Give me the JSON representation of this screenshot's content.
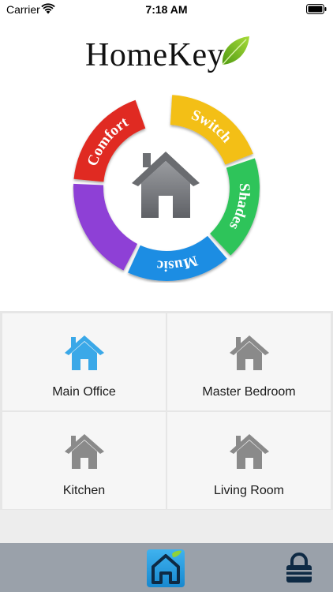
{
  "status_bar": {
    "carrier": "Carrier",
    "time": "7:18 AM"
  },
  "logo": {
    "text": "HomeKey"
  },
  "wheel": {
    "segments": [
      {
        "label": "Switch",
        "color": "#f3bf13"
      },
      {
        "label": "Shades",
        "color": "#2fc45a"
      },
      {
        "label": "Music",
        "color": "#1f8de3"
      },
      {
        "label": "",
        "color": "#8e3fd6"
      },
      {
        "label": "Comfort",
        "color": "#e02a22"
      }
    ]
  },
  "rooms": [
    {
      "label": "Main Office",
      "icon": "house-icon",
      "active": true
    },
    {
      "label": "Master Bedroom",
      "icon": "house-icon",
      "active": false
    },
    {
      "label": "Kitchen",
      "icon": "house-icon",
      "active": false
    },
    {
      "label": "Living Room",
      "icon": "house-icon",
      "active": false
    }
  ],
  "tab_bar": {
    "items": [
      {
        "icon": "home-icon",
        "active": true
      },
      {
        "icon": "lock-icon",
        "active": false
      }
    ]
  },
  "colors": {
    "active_icon": "#3aa8e8",
    "inactive_icon": "#8a8a8a",
    "tab_bar": "#9aa1aa"
  }
}
